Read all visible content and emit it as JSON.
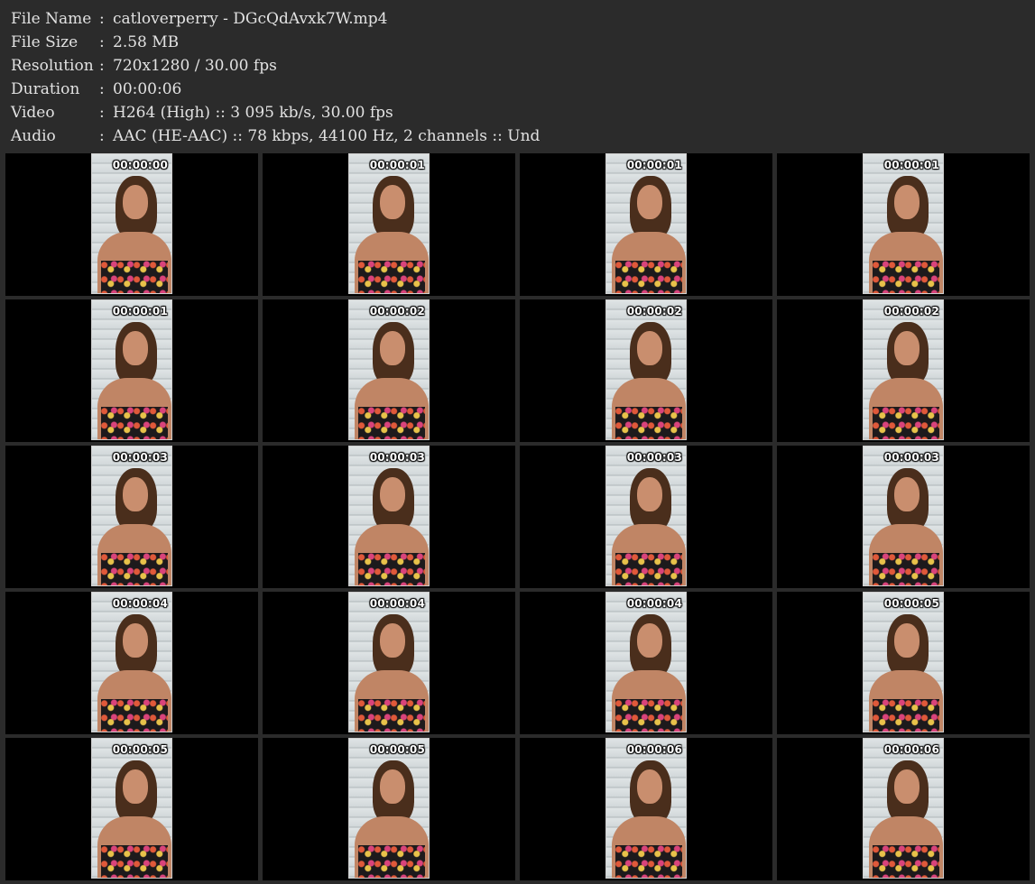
{
  "info": [
    {
      "label": "File Name",
      "value": "catloverperry - DGcQdAvxk7W.mp4"
    },
    {
      "label": "File Size",
      "value": "2.58 MB"
    },
    {
      "label": "Resolution",
      "value": "720x1280 / 30.00 fps"
    },
    {
      "label": "Duration",
      "value": "00:00:06"
    },
    {
      "label": "Video",
      "value": "H264 (High) :: 3 095 kb/s, 30.00 fps"
    },
    {
      "label": "Audio",
      "value": "AAC (HE-AAC) :: 78 kbps, 44100 Hz, 2 channels :: Und"
    }
  ],
  "separator": ":",
  "thumbnails": [
    "00:00:00",
    "00:00:01",
    "00:00:01",
    "00:00:01",
    "00:00:01",
    "00:00:02",
    "00:00:02",
    "00:00:02",
    "00:00:03",
    "00:00:03",
    "00:00:03",
    "00:00:03",
    "00:00:04",
    "00:00:04",
    "00:00:04",
    "00:00:05",
    "00:00:05",
    "00:00:05",
    "00:00:06",
    "00:00:06"
  ],
  "colors": {
    "background": "#2b2b2b",
    "text": "#e2e2e2",
    "cell": "#000000"
  }
}
